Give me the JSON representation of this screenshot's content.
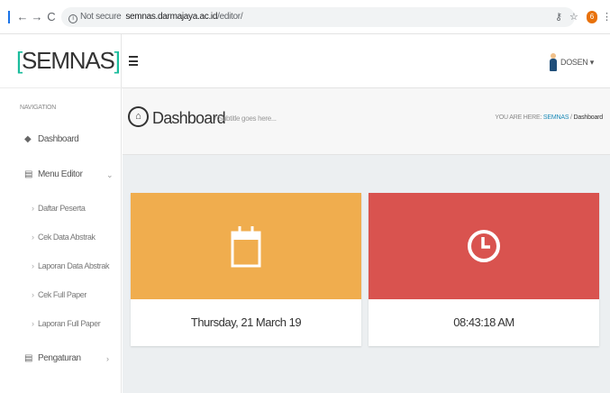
{
  "browser": {
    "security_label": "Not secure",
    "url_host": "semnas.darmajaya.ac.id",
    "url_path": "/editor/",
    "ext_badge": "6"
  },
  "sidebar": {
    "brand_open": "[",
    "brand_name": "SEMNAS",
    "brand_close": "]",
    "nav_header": "NAVIGATION",
    "items": [
      {
        "label": "Dashboard",
        "icon": "dashboard-icon"
      },
      {
        "label": "Menu Editor",
        "icon": "file-icon",
        "caret": "⌄"
      },
      {
        "label": "Pengaturan",
        "icon": "file-icon",
        "caret": "›"
      }
    ],
    "submenu": [
      {
        "label": "Daftar Peserta"
      },
      {
        "label": "Cek Data Abstrak"
      },
      {
        "label": "Laporan Data Abstrak"
      },
      {
        "label": "Cek Full Paper"
      },
      {
        "label": "Laporan Full Paper"
      }
    ]
  },
  "topbar": {
    "user_label": "DOSEN ▾"
  },
  "pagehead": {
    "title": "Dashboard",
    "subtitle": "/  Subtitle goes here...",
    "crumb_prefix": "YOU ARE HERE:",
    "crumb_link": "SEMNAS",
    "crumb_sep": "/",
    "crumb_current": "Dashboard"
  },
  "cards": [
    {
      "text": "Thursday, 21 March 19",
      "color": "#f0ad4e",
      "icon": "calendar-icon"
    },
    {
      "text": "08:43:18 AM",
      "color": "#d9534f",
      "icon": "clock-icon"
    }
  ]
}
